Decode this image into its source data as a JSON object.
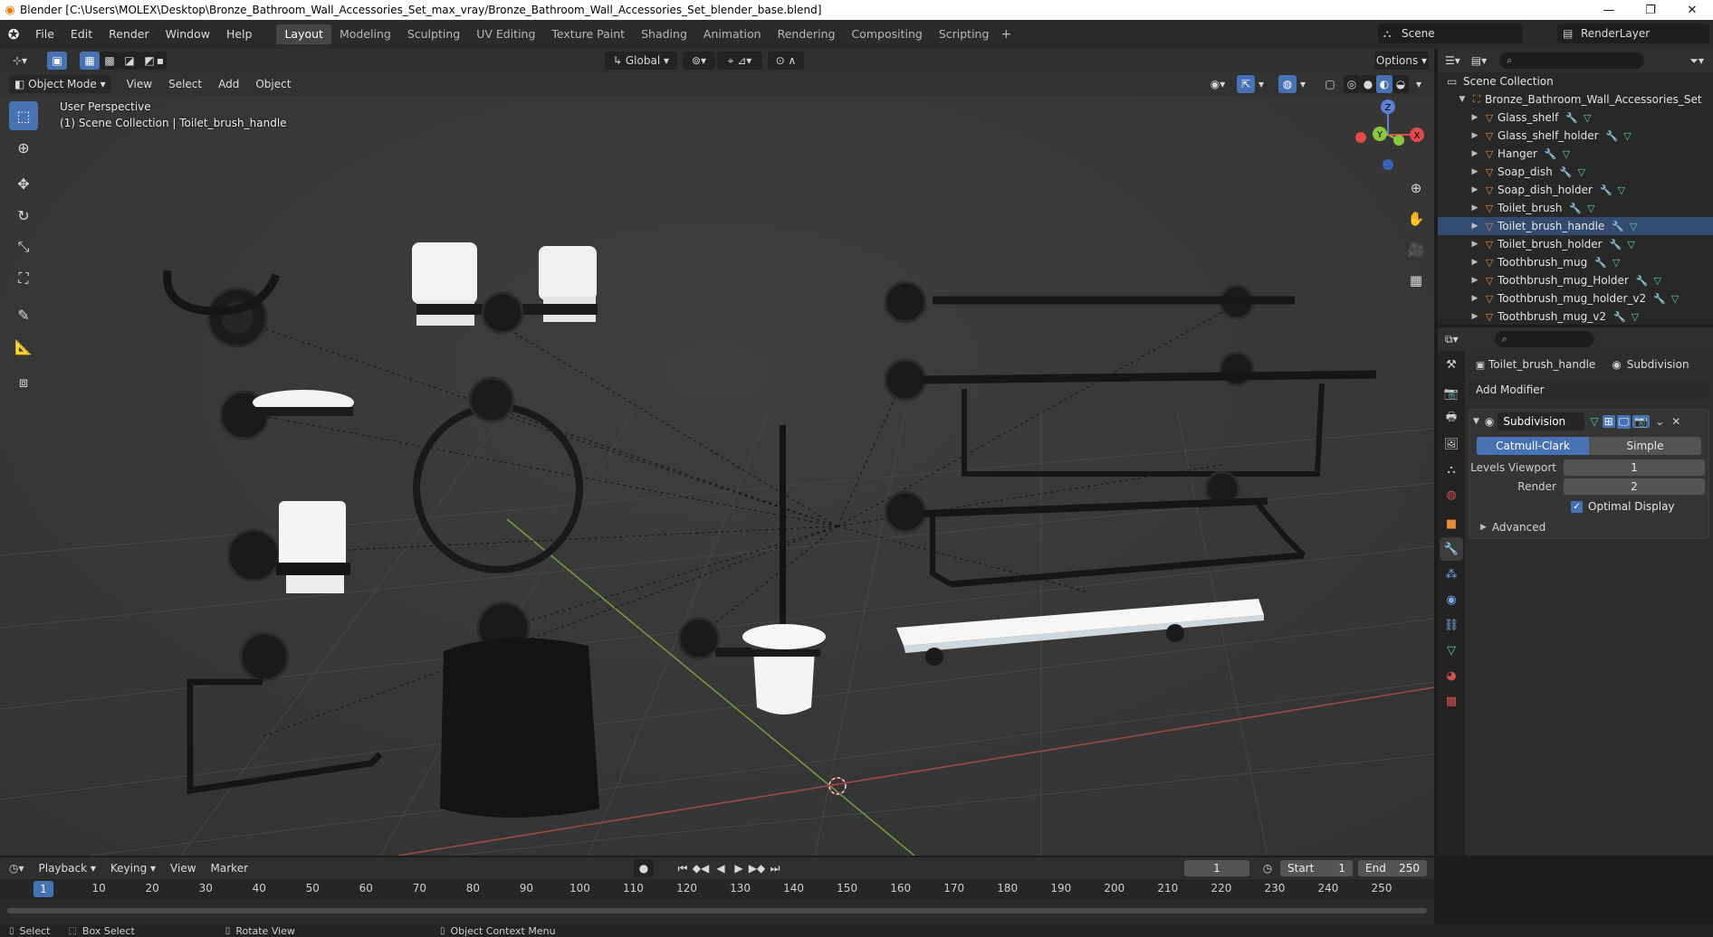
{
  "window": {
    "title": "Blender [C:\\Users\\MOLEX\\Desktop\\Bronze_Bathroom_Wall_Accessories_Set_max_vray/Bronze_Bathroom_Wall_Accessories_Set_blender_base.blend]",
    "minimize": "—",
    "restore": "❐",
    "close": "✕"
  },
  "menu": [
    "File",
    "Edit",
    "Render",
    "Window",
    "Help"
  ],
  "workspaces": [
    "Layout",
    "Modeling",
    "Sculpting",
    "UV Editing",
    "Texture Paint",
    "Shading",
    "Animation",
    "Rendering",
    "Compositing",
    "Scripting"
  ],
  "workspace_add": "+",
  "scene": "Scene",
  "render_layer": "RenderLayer",
  "viewport": {
    "mode": "Object Mode",
    "menus": [
      "View",
      "Select",
      "Add",
      "Object"
    ],
    "orientation": "Global",
    "options": "Options",
    "perspective": "User Perspective",
    "collection_info": "(1) Scene Collection | Toilet_brush_handle",
    "gizmo": {
      "z": "Z",
      "y": "Y",
      "x": "X"
    }
  },
  "outliner": {
    "root": "Scene Collection",
    "collection": "Bronze_Bathroom_Wall_Accessories_Set",
    "items": [
      "Glass_shelf",
      "Glass_shelf_holder",
      "Hanger",
      "Soap_dish",
      "Soap_dish_holder",
      "Toilet_brush",
      "Toilet_brush_handle",
      "Toilet_brush_holder",
      "Toothbrush_mug",
      "Toothbrush_mug_Holder",
      "Toothbrush_mug_holder_v2",
      "Toothbrush_mug_v2"
    ],
    "selected_index": 6
  },
  "properties": {
    "object": "Toilet_brush_handle",
    "modifier_context": "Subdivision",
    "add_modifier": "Add Modifier",
    "modifier": {
      "name": "Subdivision",
      "algorithm_selected": "Catmull-Clark",
      "algorithm_other": "Simple",
      "levels_viewport_label": "Levels Viewport",
      "levels_viewport": "1",
      "render_label": "Render",
      "render": "2",
      "optimal_display_label": "Optimal Display",
      "advanced": "Advanced"
    }
  },
  "timeline": {
    "menus": [
      "Playback",
      "Keying",
      "View",
      "Marker"
    ],
    "current_frame": "1",
    "start_label": "Start",
    "start": "1",
    "end_label": "End",
    "end": "250",
    "ticks": [
      "1",
      "10",
      "20",
      "30",
      "40",
      "50",
      "60",
      "70",
      "80",
      "90",
      "100",
      "110",
      "120",
      "130",
      "140",
      "150",
      "160",
      "170",
      "180",
      "190",
      "200",
      "210",
      "220",
      "230",
      "240",
      "250"
    ]
  },
  "status": {
    "select": "Select",
    "box_select": "Box Select",
    "rotate_view": "Rotate View",
    "context_menu": "Object Context Menu"
  },
  "colors": {
    "accent": "#4772b3",
    "viewport_bg": "#393939",
    "object_icon": "#e88a3a",
    "mesh_icon": "#56cfa9"
  }
}
